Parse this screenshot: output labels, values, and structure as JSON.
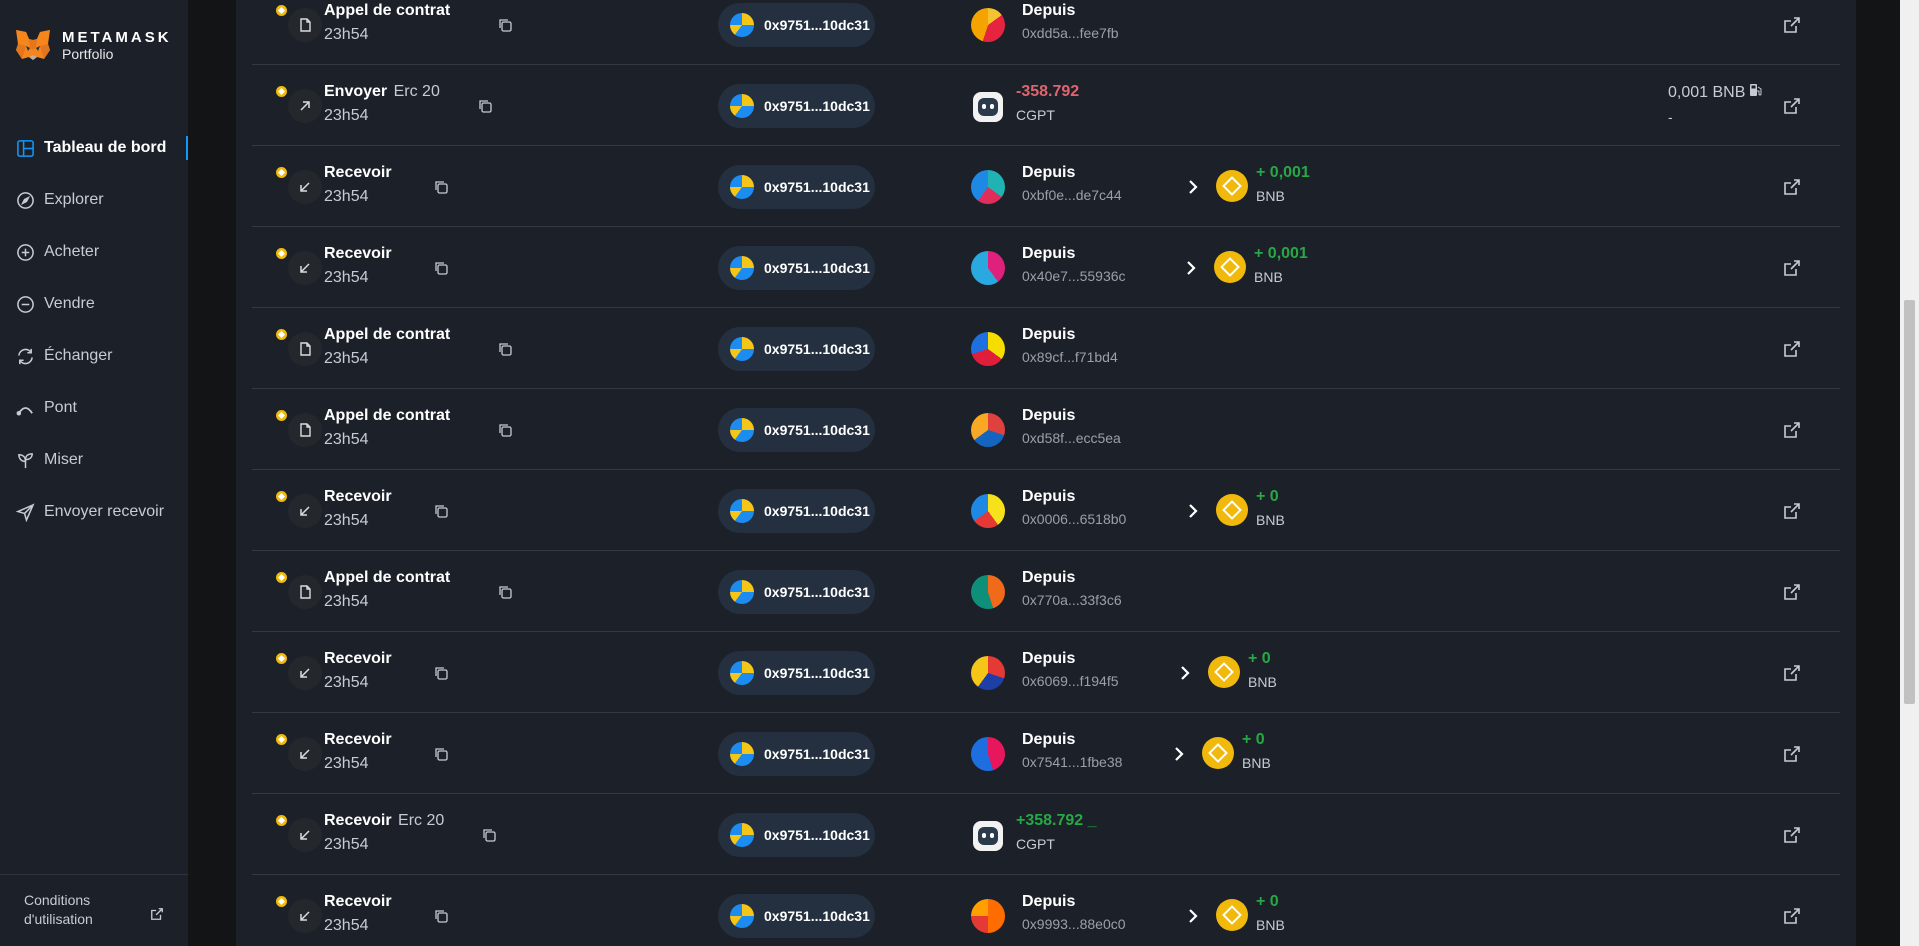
{
  "brand": {
    "name": "METAMASK",
    "sub": "Portfolio"
  },
  "nav": [
    {
      "label": "Tableau de bord",
      "icon": "dashboard-icon",
      "active": true
    },
    {
      "label": "Explorer",
      "icon": "compass-icon"
    },
    {
      "label": "Acheter",
      "icon": "plus-circle-icon"
    },
    {
      "label": "Vendre",
      "icon": "minus-circle-icon"
    },
    {
      "label": "Échanger",
      "icon": "swap-icon"
    },
    {
      "label": "Pont",
      "icon": "bridge-icon"
    },
    {
      "label": "Miser",
      "icon": "sprout-icon"
    },
    {
      "label": "Envoyer recevoir",
      "icon": "send-icon"
    }
  ],
  "footer": {
    "terms": "Conditions d'utilisation"
  },
  "wallet": "0x9751...10dc31",
  "colors": {
    "accent": "#1098fc",
    "positive": "#28a745",
    "negative": "#e06470",
    "bnb": "#f0b90b"
  },
  "transactions": [
    {
      "type": "Appel de contrat",
      "standard": "",
      "time": "23h54",
      "icon": "contract-icon",
      "wallet": "0x9751...10dc31",
      "from_label": "Depuis",
      "from_address": "0xdd5a...fee7fb",
      "amount": "",
      "symbol": "",
      "fee": "",
      "fee_sub": ""
    },
    {
      "type": "Envoyer",
      "standard": "Erc 20",
      "time": "23h54",
      "icon": "send-arrow-icon",
      "wallet": "0x9751...10dc31",
      "from_label": "",
      "from_address": "",
      "amount": "-358.792",
      "symbol": "CGPT",
      "fee": "0,001 BNB",
      "fee_sub": "-"
    },
    {
      "type": "Recevoir",
      "standard": "",
      "time": "23h54",
      "icon": "receive-arrow-icon",
      "wallet": "0x9751...10dc31",
      "from_label": "Depuis",
      "from_address": "0xbf0e...de7c44",
      "amount": "+ 0,001",
      "symbol": "BNB",
      "fee": "",
      "fee_sub": ""
    },
    {
      "type": "Recevoir",
      "standard": "",
      "time": "23h54",
      "icon": "receive-arrow-icon",
      "wallet": "0x9751...10dc31",
      "from_label": "Depuis",
      "from_address": "0x40e7...55936c",
      "amount": "+ 0,001",
      "symbol": "BNB",
      "fee": "",
      "fee_sub": ""
    },
    {
      "type": "Appel de contrat",
      "standard": "",
      "time": "23h54",
      "icon": "contract-icon",
      "wallet": "0x9751...10dc31",
      "from_label": "Depuis",
      "from_address": "0x89cf...f71bd4",
      "amount": "",
      "symbol": "",
      "fee": "",
      "fee_sub": ""
    },
    {
      "type": "Appel de contrat",
      "standard": "",
      "time": "23h54",
      "icon": "contract-icon",
      "wallet": "0x9751...10dc31",
      "from_label": "Depuis",
      "from_address": "0xd58f...ecc5ea",
      "amount": "",
      "symbol": "",
      "fee": "",
      "fee_sub": ""
    },
    {
      "type": "Recevoir",
      "standard": "",
      "time": "23h54",
      "icon": "receive-arrow-icon",
      "wallet": "0x9751...10dc31",
      "from_label": "Depuis",
      "from_address": "0x0006...6518b0",
      "amount": "+ 0",
      "symbol": "BNB",
      "fee": "",
      "fee_sub": ""
    },
    {
      "type": "Appel de contrat",
      "standard": "",
      "time": "23h54",
      "icon": "contract-icon",
      "wallet": "0x9751...10dc31",
      "from_label": "Depuis",
      "from_address": "0x770a...33f3c6",
      "amount": "",
      "symbol": "",
      "fee": "",
      "fee_sub": ""
    },
    {
      "type": "Recevoir",
      "standard": "",
      "time": "23h54",
      "icon": "receive-arrow-icon",
      "wallet": "0x9751...10dc31",
      "from_label": "Depuis",
      "from_address": "0x6069...f194f5",
      "amount": "+ 0",
      "symbol": "BNB",
      "fee": "",
      "fee_sub": ""
    },
    {
      "type": "Recevoir",
      "standard": "",
      "time": "23h54",
      "icon": "receive-arrow-icon",
      "wallet": "0x9751...10dc31",
      "from_label": "Depuis",
      "from_address": "0x7541...1fbe38",
      "amount": "+ 0",
      "symbol": "BNB",
      "fee": "",
      "fee_sub": ""
    },
    {
      "type": "Recevoir",
      "standard": "Erc 20",
      "time": "23h54",
      "icon": "receive-arrow-icon",
      "wallet": "0x9751...10dc31",
      "from_label": "",
      "from_address": "",
      "amount": "+358.792 _",
      "symbol": "CGPT",
      "fee": "",
      "fee_sub": ""
    },
    {
      "type": "Recevoir",
      "standard": "",
      "time": "23h54",
      "icon": "receive-arrow-icon",
      "wallet": "0x9751...10dc31",
      "from_label": "Depuis",
      "from_address": "0x9993...88e0c0",
      "amount": "+ 0",
      "symbol": "BNB",
      "fee": "",
      "fee_sub": ""
    }
  ]
}
